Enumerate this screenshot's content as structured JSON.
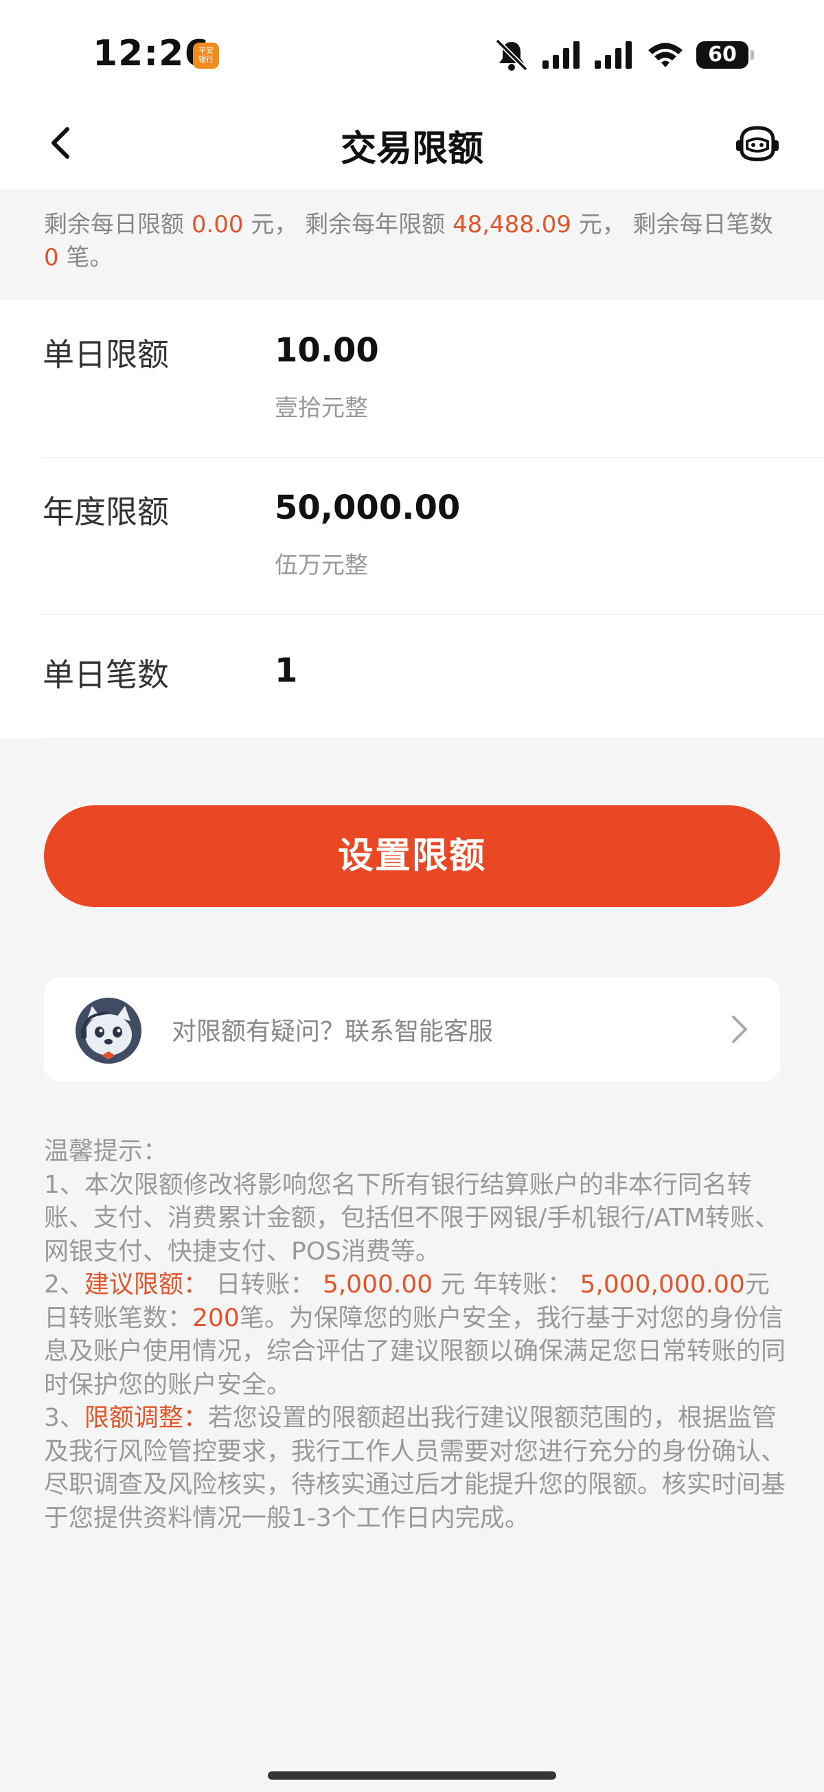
{
  "status_bar": {
    "time": "12:26",
    "app_badge": "平安\n银行",
    "battery": "60",
    "icons": [
      "mute-bell-icon",
      "signal-icon",
      "signal-icon",
      "wifi-icon",
      "battery-icon"
    ]
  },
  "nav": {
    "title": "交易限额",
    "back_icon": "chevron-left-icon",
    "assistant_icon": "robot-icon"
  },
  "notice": {
    "p1": "剩余每日限额 ",
    "daily_remaining": "0.00",
    "p2": " 元， 剩余每年限额 ",
    "yearly_remaining": "48,488.09",
    "p3": " 元， 剩余每日笔数 ",
    "count_remaining": "0",
    "p4": " 笔。"
  },
  "form": {
    "daily": {
      "label": "单日限额",
      "value": "10.00",
      "chinese": "壹拾元整"
    },
    "yearly": {
      "label": "年度限额",
      "value": "50,000.00",
      "chinese": "伍万元整"
    },
    "count": {
      "label": "单日笔数",
      "value": "1"
    }
  },
  "submit_label": "设置限额",
  "service": {
    "text": "对限额有疑问？联系智能客服",
    "arrow_icon": "chevron-right-icon"
  },
  "tips": {
    "heading": "温馨提示：",
    "t1": "1、本次限额修改将影响您名下所有银行结算账户的非本行同名转账、支付、消费累计金额，包括但不限于网银/手机银行/ATM转账、网银支付、快捷支付、POS消费等。",
    "t2_prefix": "2、",
    "t2_key": "建议限额：",
    "t2_a": " 日转账： ",
    "t2_daily": "5,000.00",
    "t2_b": " 元 年转账： ",
    "t2_yearly": "5,000,000.00",
    "t2_c": "元 日转账笔数：",
    "t2_count": "200",
    "t2_d": "笔。为保障您的账户安全，我行基于对您的身份信息及账户使用情况，综合评估了建议限额以确保满足您日常转账的同时保护您的账户安全。",
    "t3_prefix": "3、",
    "t3_key": "限额调整：",
    "t3_text": "若您设置的限额超出我行建议限额范围的，根据监管及我行风险管控要求，我行工作人员需要对您进行充分的身份确认、尽职调查及风险核实，待核实通过后才能提升您的限额。核实时间基于您提供资料情况一般1-3个工作日内完成。"
  },
  "colors": {
    "accent": "#ea4724",
    "highlight": "#e2552a"
  }
}
